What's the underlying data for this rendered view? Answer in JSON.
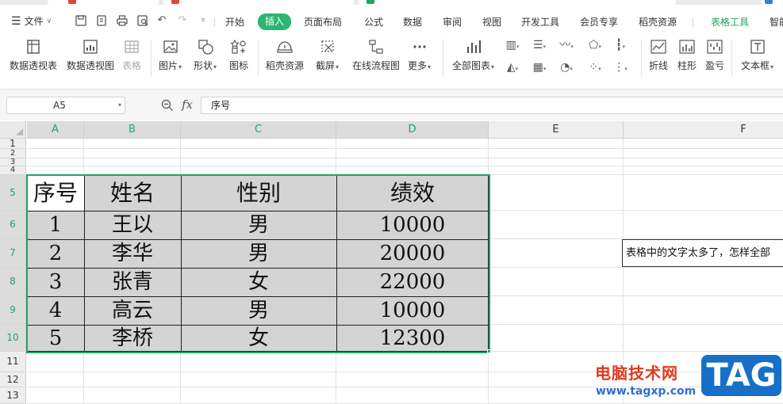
{
  "menu": {
    "file_label": "文件",
    "tabs": [
      {
        "label": "开始"
      },
      {
        "label": "插入",
        "active": true
      },
      {
        "label": "页面布局"
      },
      {
        "label": "公式"
      },
      {
        "label": "数据"
      },
      {
        "label": "审阅"
      },
      {
        "label": "视图"
      },
      {
        "label": "开发工具"
      },
      {
        "label": "会员专享"
      },
      {
        "label": "稻壳资源"
      },
      {
        "label": "表格工具",
        "context": true
      },
      {
        "label": "智能"
      }
    ]
  },
  "ribbon": {
    "pivot_table": "数据透视表",
    "pivot_chart": "数据透视图",
    "table": "表格",
    "picture": "图片",
    "shape": "形状",
    "icon": "图标",
    "docer_assets": "稻壳资源",
    "screenshot": "截屏",
    "online_flowchart": "在线流程图",
    "more": "更多",
    "all_charts": "全部图表",
    "line": "折线",
    "column": "柱形",
    "winloss": "盈亏",
    "textbox": "文本框"
  },
  "formula_bar": {
    "name_box": "A5",
    "fx": "fx",
    "content": "序号"
  },
  "grid": {
    "columns": [
      "A",
      "B",
      "C",
      "D",
      "E",
      "F"
    ],
    "selected_columns": [
      "A",
      "B",
      "C",
      "D"
    ],
    "rows": [
      "1",
      "2",
      "3",
      "4",
      "5",
      "6",
      "7",
      "8",
      "9",
      "10",
      "11",
      "12",
      "13"
    ],
    "selected_rows": [
      "5",
      "6",
      "7",
      "8",
      "9",
      "10"
    ]
  },
  "table": {
    "headers": [
      "序号",
      "姓名",
      "性别",
      "绩效"
    ],
    "rows": [
      [
        "1",
        "王以",
        "男",
        "10000"
      ],
      [
        "2",
        "李华",
        "男",
        "20000"
      ],
      [
        "3",
        "张青",
        "女",
        "22000"
      ],
      [
        "4",
        "高云",
        "男",
        "10000"
      ],
      [
        "5",
        "李桥",
        "女",
        "12300"
      ]
    ]
  },
  "comment_text": "表格中的文字太多了，怎样全部",
  "watermark": {
    "site_name": "电脑技术网",
    "url": "www.tagxp.com",
    "tag": "TAG"
  },
  "colors": {
    "accent_green": "#21a366",
    "active_tab": "#2bb673",
    "selection_fill": "#d4d4d4",
    "watermark_red": "#e03a1e",
    "watermark_blue": "#1670c8"
  }
}
